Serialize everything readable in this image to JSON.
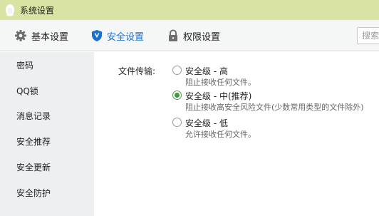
{
  "window": {
    "title": "系统设置"
  },
  "toolbar": {
    "tabs": [
      {
        "label": "基本设置",
        "icon": "gear-icon",
        "active": false
      },
      {
        "label": "安全设置",
        "icon": "shield-icon",
        "active": true
      },
      {
        "label": "权限设置",
        "icon": "lock-icon",
        "active": false
      }
    ],
    "search_placeholder": "搜索"
  },
  "sidebar": {
    "items": [
      {
        "label": "密码"
      },
      {
        "label": "QQ锁"
      },
      {
        "label": "消息记录"
      },
      {
        "label": "安全推荐"
      },
      {
        "label": "安全更新"
      },
      {
        "label": "安全防护"
      }
    ]
  },
  "main": {
    "file_transfer_label": "文件传输:",
    "options": [
      {
        "title": "安全级 - 高",
        "desc": "阻止接收任何文件。",
        "selected": false
      },
      {
        "title": "安全级 - 中(推荐)",
        "desc": "阻止接收高安全风险文件(少数常用类型的文件除外)",
        "selected": true
      },
      {
        "title": "安全级 - 低",
        "desc": "允许接收任何文件。",
        "selected": false
      }
    ]
  },
  "colors": {
    "titlebar": "#d8e3a4",
    "active_tab": "#1a6fd0",
    "radio_selected": "#3f9a3b",
    "sidebar_bg": "#eeeff0"
  }
}
